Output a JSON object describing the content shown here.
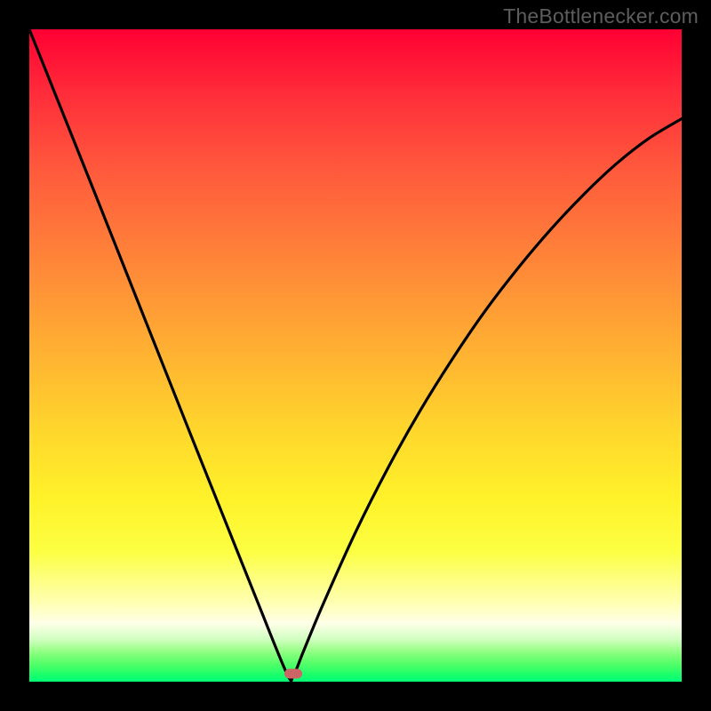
{
  "watermark": "TheBottlenecker.com",
  "marker": {
    "color": "#cc6666",
    "x_frac": 0.405,
    "y_frac": 0.988
  },
  "chart_data": {
    "type": "line",
    "title": "",
    "xlabel": "",
    "ylabel": "",
    "xlim": [
      0,
      1
    ],
    "ylim": [
      0,
      1
    ],
    "annotations": [
      "TheBottlenecker.com"
    ],
    "grid": false,
    "legend": false,
    "x": [
      0.0,
      0.05,
      0.1,
      0.15,
      0.2,
      0.25,
      0.3,
      0.35,
      0.395,
      0.405,
      0.42,
      0.45,
      0.5,
      0.55,
      0.6,
      0.65,
      0.7,
      0.75,
      0.8,
      0.85,
      0.9,
      0.95,
      1.0
    ],
    "y": [
      1.0,
      0.875,
      0.75,
      0.624,
      0.498,
      0.372,
      0.247,
      0.122,
      0.012,
      0.01,
      0.046,
      0.118,
      0.229,
      0.328,
      0.417,
      0.497,
      0.57,
      0.635,
      0.694,
      0.747,
      0.794,
      0.833,
      0.863
    ],
    "background_gradient": {
      "stops": [
        {
          "pos": 0.0,
          "color": "#ff0033"
        },
        {
          "pos": 0.5,
          "color": "#ffb332"
        },
        {
          "pos": 0.8,
          "color": "#fcff42"
        },
        {
          "pos": 0.93,
          "color": "#d1ffc2"
        },
        {
          "pos": 1.0,
          "color": "#00ff78"
        }
      ]
    },
    "marker": {
      "x": 0.405,
      "y": 0.012,
      "color": "#cc6666",
      "shape": "pill"
    }
  }
}
